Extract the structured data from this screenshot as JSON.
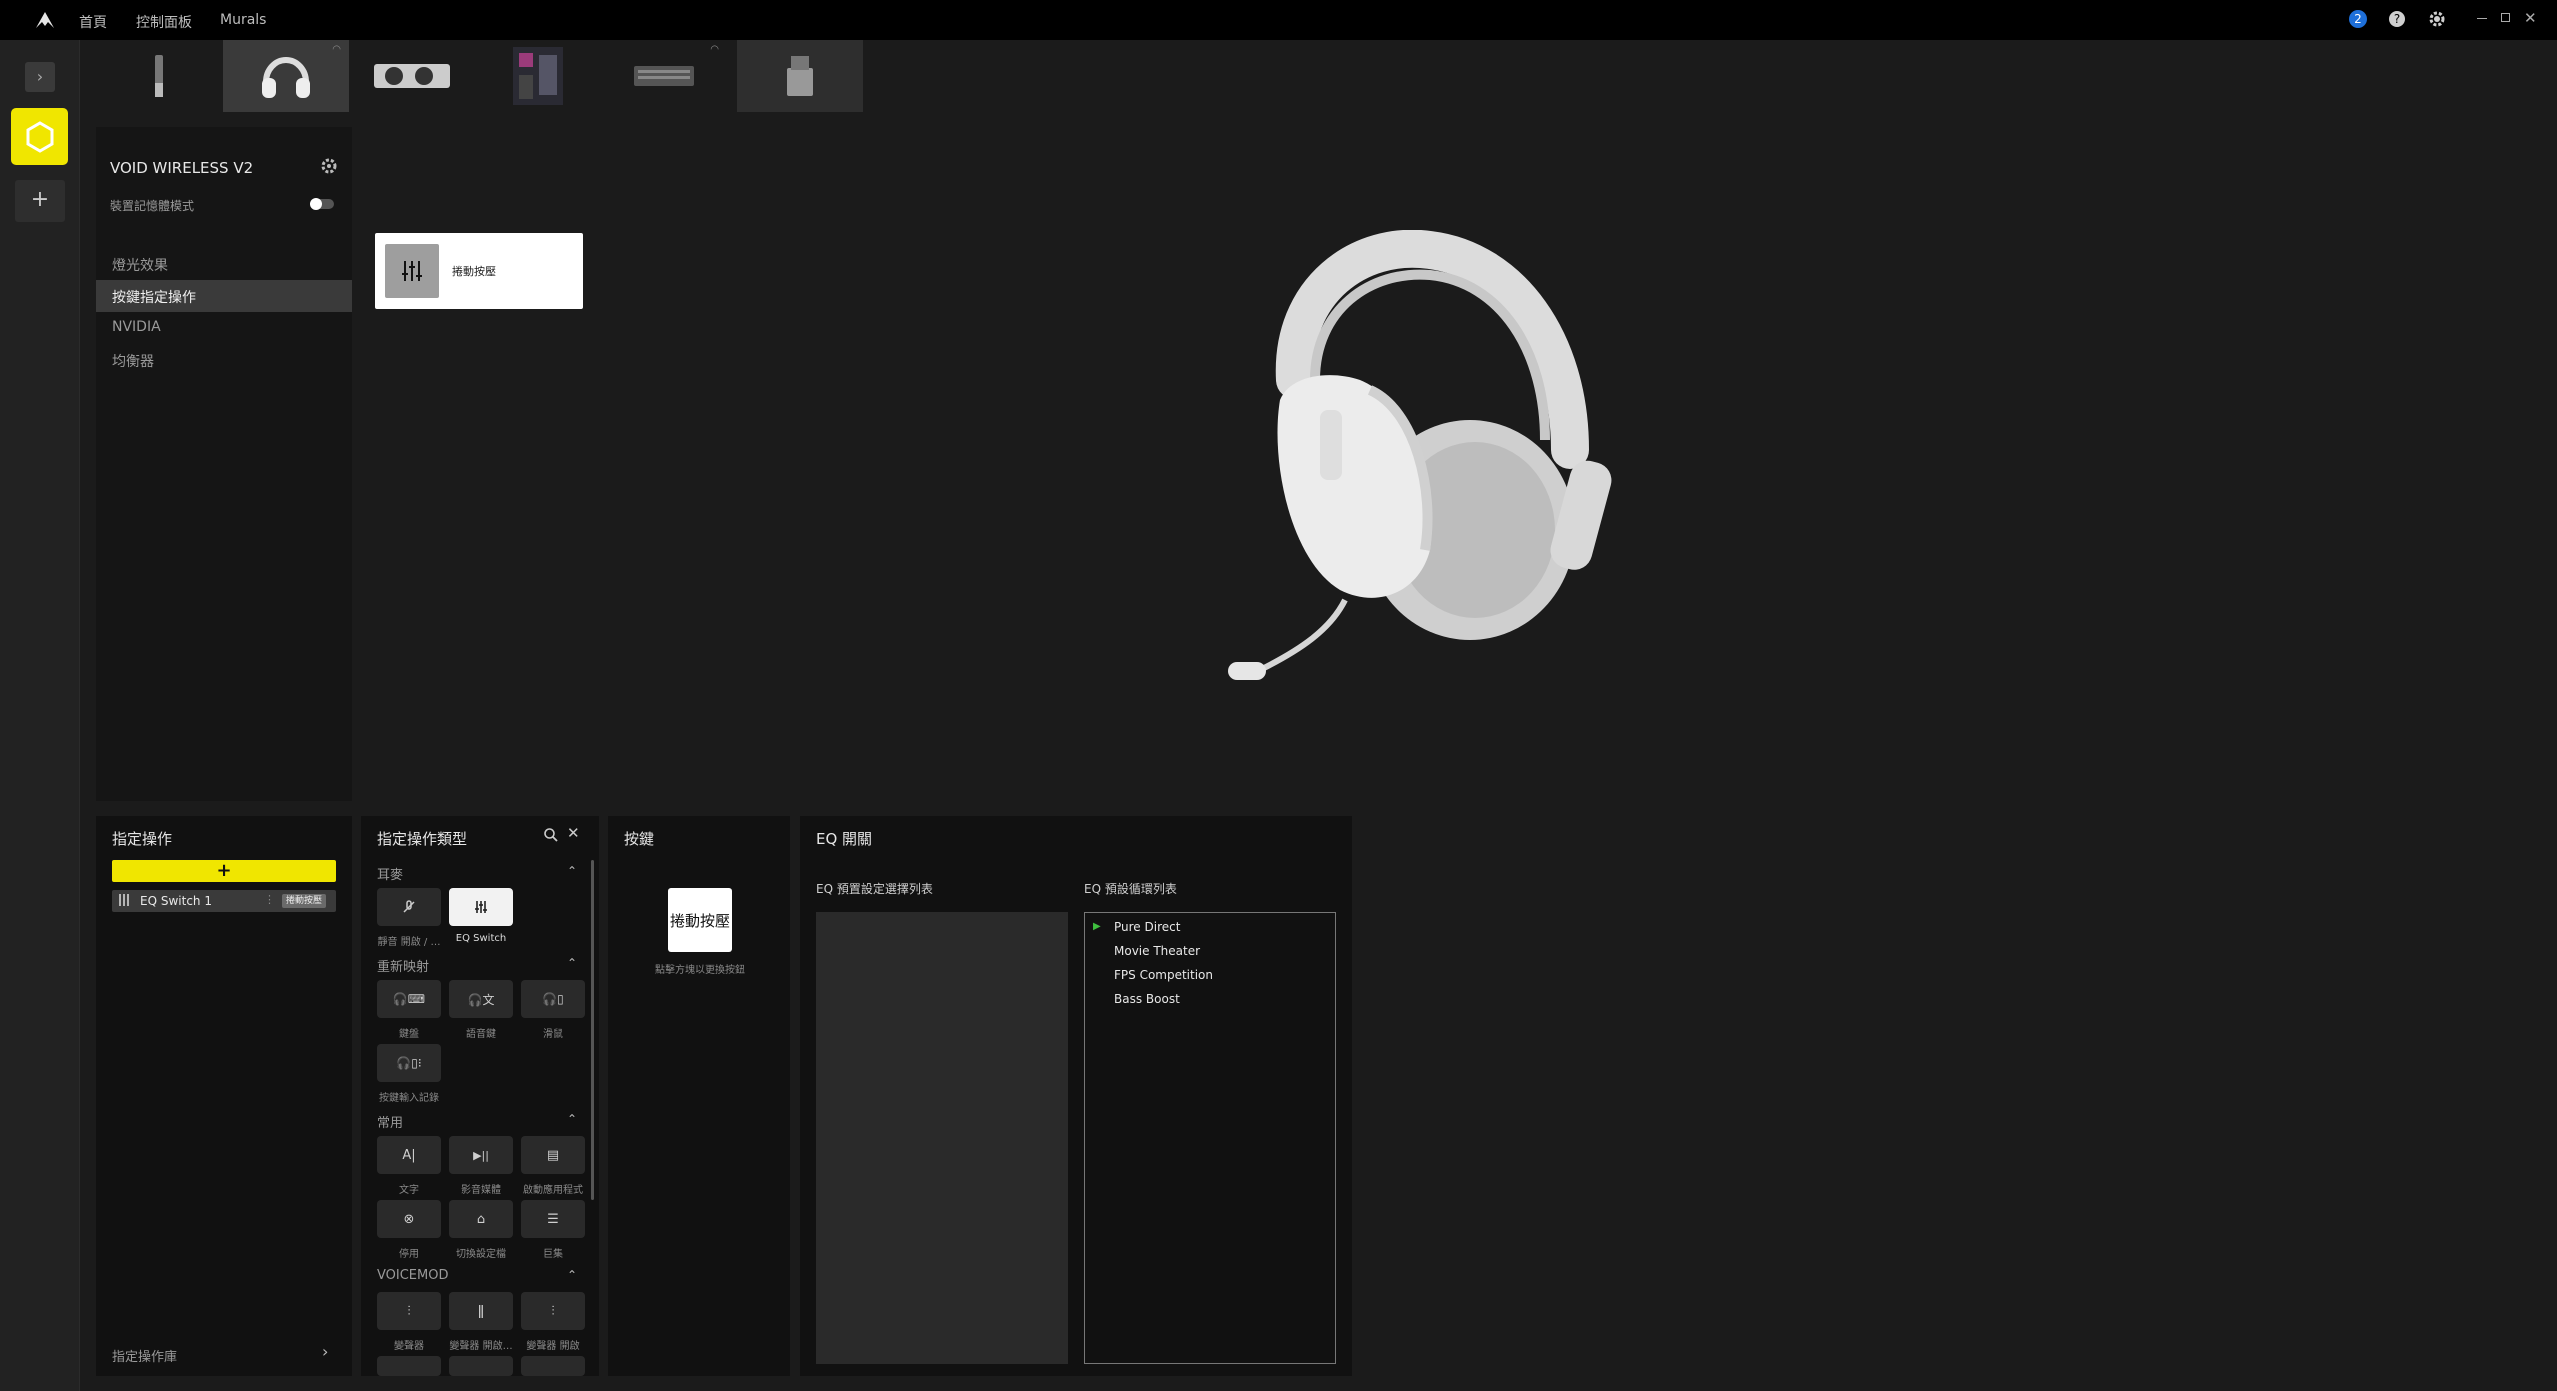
{
  "titlebar": {
    "nav": [
      "首頁",
      "控制面板",
      "Murals"
    ],
    "notification_count": "2",
    "icons": [
      "corsair-logo-icon",
      "help-icon",
      "settings-icon",
      "minimize-icon",
      "restore-icon",
      "close-icon"
    ]
  },
  "device": {
    "name": "VOID WIRELESS V2",
    "memory_mode_label": "裝置記憶體模式",
    "memory_mode_on": false,
    "menu": [
      "燈光效果",
      "按鍵指定操作",
      "NVIDIA",
      "均衡器"
    ],
    "menu_selected": 1
  },
  "key_card": {
    "label": "捲動按壓"
  },
  "assign_panel": {
    "title": "指定操作",
    "add_label": "+",
    "item_name": "EQ Switch 1",
    "item_tag": "捲動按壓",
    "library_label": "指定操作庫"
  },
  "types_panel": {
    "title": "指定操作類型",
    "sections": [
      {
        "title": "耳麥",
        "items": [
          "靜音 開啟 / …",
          "EQ Switch"
        ]
      },
      {
        "title": "重新映射",
        "items": [
          "鍵盤",
          "語音鍵",
          "滑鼠",
          "按鍵輸入記錄"
        ]
      },
      {
        "title": "常用",
        "items": [
          "文字",
          "影音媒體",
          "啟動應用程式",
          "停用",
          "切換設定檔",
          "巨集"
        ]
      },
      {
        "title": "VOICEMOD",
        "items": [
          "變聲器",
          "變聲器 開啟…",
          "變聲器 開啟"
        ]
      }
    ]
  },
  "keys_panel": {
    "title": "按鍵",
    "key_label": "捲動按壓",
    "hint": "點擊方塊以更換按鈕"
  },
  "eq_panel": {
    "title": "EQ 開關",
    "preset_list_title": "EQ 預置設定選擇列表",
    "cycle_list_title": "EQ 預設循環列表",
    "cycle_items": [
      "Pure Direct",
      "Movie Theater",
      "FPS Competition",
      "Bass Boost"
    ],
    "accent": "#3fbf3f"
  },
  "colors": {
    "accent_yellow": "#f0e600",
    "notification_blue": "#1e6fd9"
  }
}
